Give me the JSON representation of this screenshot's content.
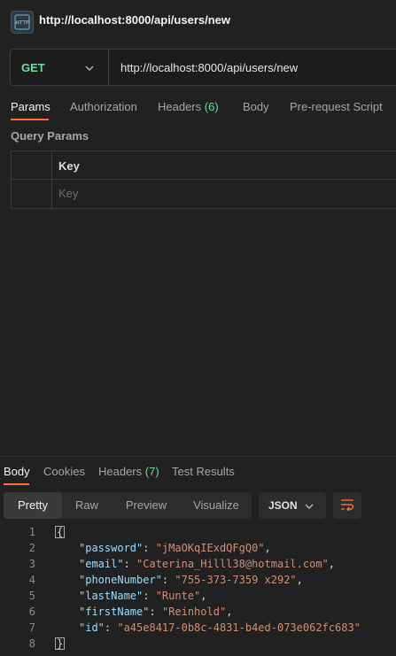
{
  "header": {
    "title": "http://localhost:8000/api/users/new",
    "icon": "http-request-icon"
  },
  "request": {
    "method": "GET",
    "url": "http://localhost:8000/api/users/new"
  },
  "tabs": [
    {
      "label": "Params",
      "active": true
    },
    {
      "label": "Authorization"
    },
    {
      "label": "Headers",
      "count": "(6)"
    },
    {
      "label": "Body"
    },
    {
      "label": "Pre-request Script"
    }
  ],
  "query_params": {
    "title": "Query Params",
    "key_header": "Key",
    "key_placeholder": "Key"
  },
  "response": {
    "tabs": [
      {
        "label": "Body",
        "active": true
      },
      {
        "label": "Cookies"
      },
      {
        "label": "Headers",
        "count": "(7)"
      },
      {
        "label": "Test Results"
      }
    ],
    "views": [
      "Pretty",
      "Raw",
      "Preview",
      "Visualize"
    ],
    "active_view": "Pretty",
    "format": "JSON",
    "lines": [
      {
        "n": "1",
        "open": "{"
      },
      {
        "n": "2",
        "key": "\"password\"",
        "val": "\"jMaOKqIExdQFgQ0\"",
        "comma": ","
      },
      {
        "n": "3",
        "key": "\"email\"",
        "val": "\"Caterina_Hilll38@hotmail.com\"",
        "comma": ","
      },
      {
        "n": "4",
        "key": "\"phoneNumber\"",
        "val": "\"755-373-7359 x292\"",
        "comma": ","
      },
      {
        "n": "5",
        "key": "\"lastName\"",
        "val": "\"Runte\"",
        "comma": ","
      },
      {
        "n": "6",
        "key": "\"firstName\"",
        "val": "\"Reinhold\"",
        "comma": ","
      },
      {
        "n": "7",
        "key": "\"id\"",
        "val": "\"a45e8417-0b8c-4831-b4ed-073e062fc683\"",
        "comma": ""
      },
      {
        "n": "8",
        "close": "}"
      }
    ]
  },
  "colors": {
    "accent": "#ff6c37",
    "method_get": "#6bdd9a",
    "json_key": "#9cdcfe",
    "json_string": "#ce9178"
  }
}
